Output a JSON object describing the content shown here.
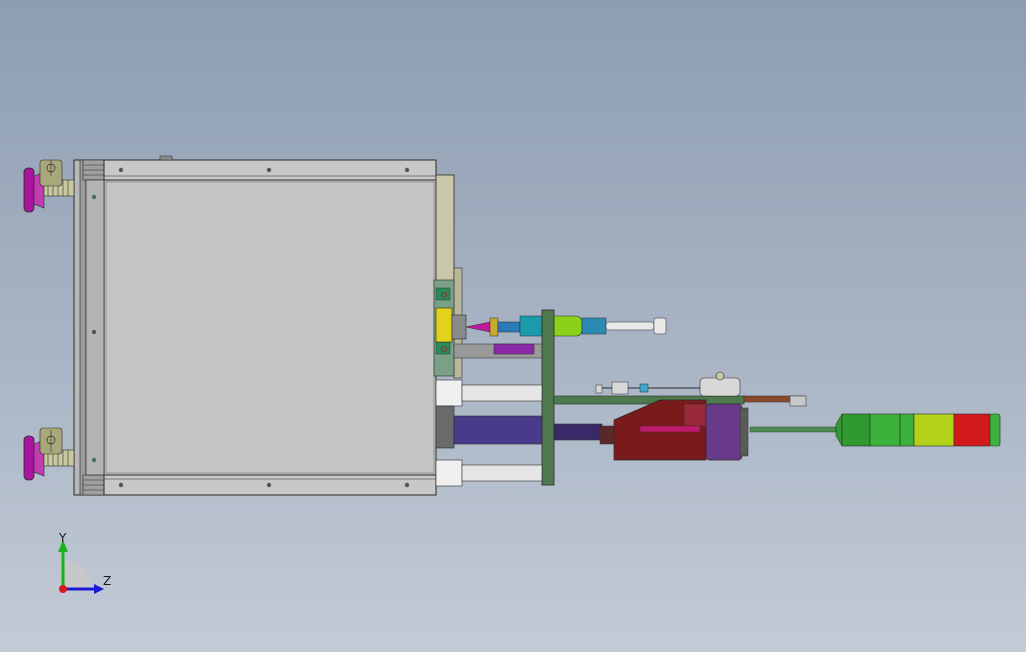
{
  "viewport": {
    "background_top": "#8e9db2",
    "background_bottom": "#c3cbd6"
  },
  "triad": {
    "y_label": "Y",
    "z_label": "Z",
    "y_color": "#1ab21a",
    "z_color": "#1a1ad6",
    "origin_color": "#d61a1a"
  },
  "model": {
    "housing_color": "#c2c2c2",
    "edge_color": "#2a2a2a",
    "foot_pad_color": "#a8169e",
    "plate_color": "#4f7a4f",
    "rod_color": "#e6e6e6",
    "cylinder_color": "#4a3a8a",
    "block_color": "#7a1a1a",
    "motor_color": "#6a3a8a",
    "tower_segments": [
      "#2f9a2f",
      "#3cb23c",
      "#b4d21a",
      "#d21a1a",
      "#3cb23c"
    ]
  }
}
